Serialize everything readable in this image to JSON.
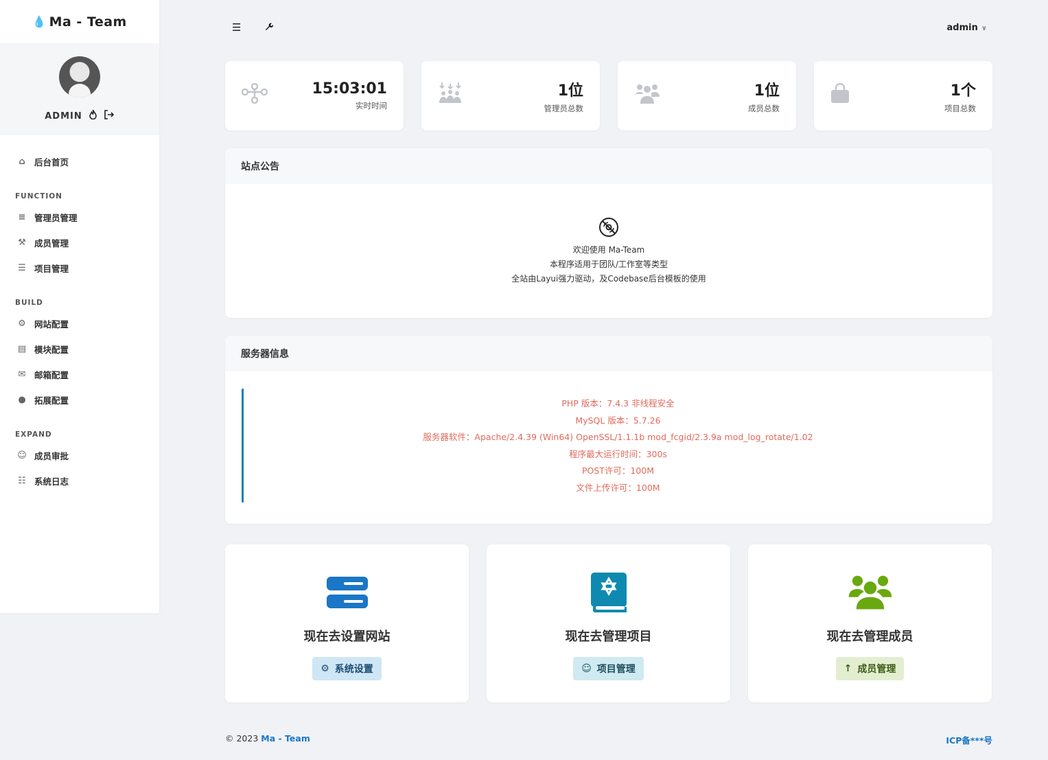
{
  "brand": {
    "icon": "flame-icon",
    "name": "Ma - Team"
  },
  "user": {
    "name": "ADMIN"
  },
  "sidebar": {
    "home": "后台首页",
    "sections": [
      {
        "title": "FUNCTION",
        "items": [
          "管理员管理",
          "成员管理",
          "项目管理"
        ]
      },
      {
        "title": "BUILD",
        "items": [
          "网站配置",
          "模块配置",
          "邮箱配置",
          "拓展配置"
        ]
      },
      {
        "title": "EXPAND",
        "items": [
          "成员审批",
          "系统日志"
        ]
      }
    ]
  },
  "topbar": {
    "user": "admin"
  },
  "stats": [
    {
      "value": "15:03:01",
      "label": "实时时间",
      "icon": "sitemap-icon"
    },
    {
      "value": "1位",
      "label": "管理员总数",
      "icon": "people-arrows-icon"
    },
    {
      "value": "1位",
      "label": "成员总数",
      "icon": "users-icon"
    },
    {
      "value": "1个",
      "label": "项目总数",
      "icon": "bag-icon"
    }
  ],
  "notice": {
    "title": "站点公告",
    "lines": [
      "欢迎使用 Ma-Team",
      "本程序适用于团队/工作室等类型",
      "全站由Layui强力驱动，及Codebase后台模板的使用"
    ]
  },
  "server": {
    "title": "服务器信息",
    "lines": [
      "PHP 版本：7.4.3 非线程安全",
      "MySQL 版本：5.7.26",
      "服务器软件：Apache/2.4.39 (Win64) OpenSSL/1.1.1b mod_fcgid/2.3.9a mod_log_rotate/1.02",
      "程序最大运行时间：300s",
      "POST许可：100M",
      "文件上传许可：100M"
    ]
  },
  "actions": [
    {
      "title": "现在去设置网站",
      "button": "系统设置",
      "color": "#1a76c6"
    },
    {
      "title": "现在去管理项目",
      "button": "项目管理",
      "color": "#0e8ab0"
    },
    {
      "title": "现在去管理成员",
      "button": "成员管理",
      "color": "#6aa80f"
    }
  ],
  "footer": {
    "copyright": "© 2023",
    "brand": "Ma - Team",
    "icp": "ICP备***号"
  }
}
